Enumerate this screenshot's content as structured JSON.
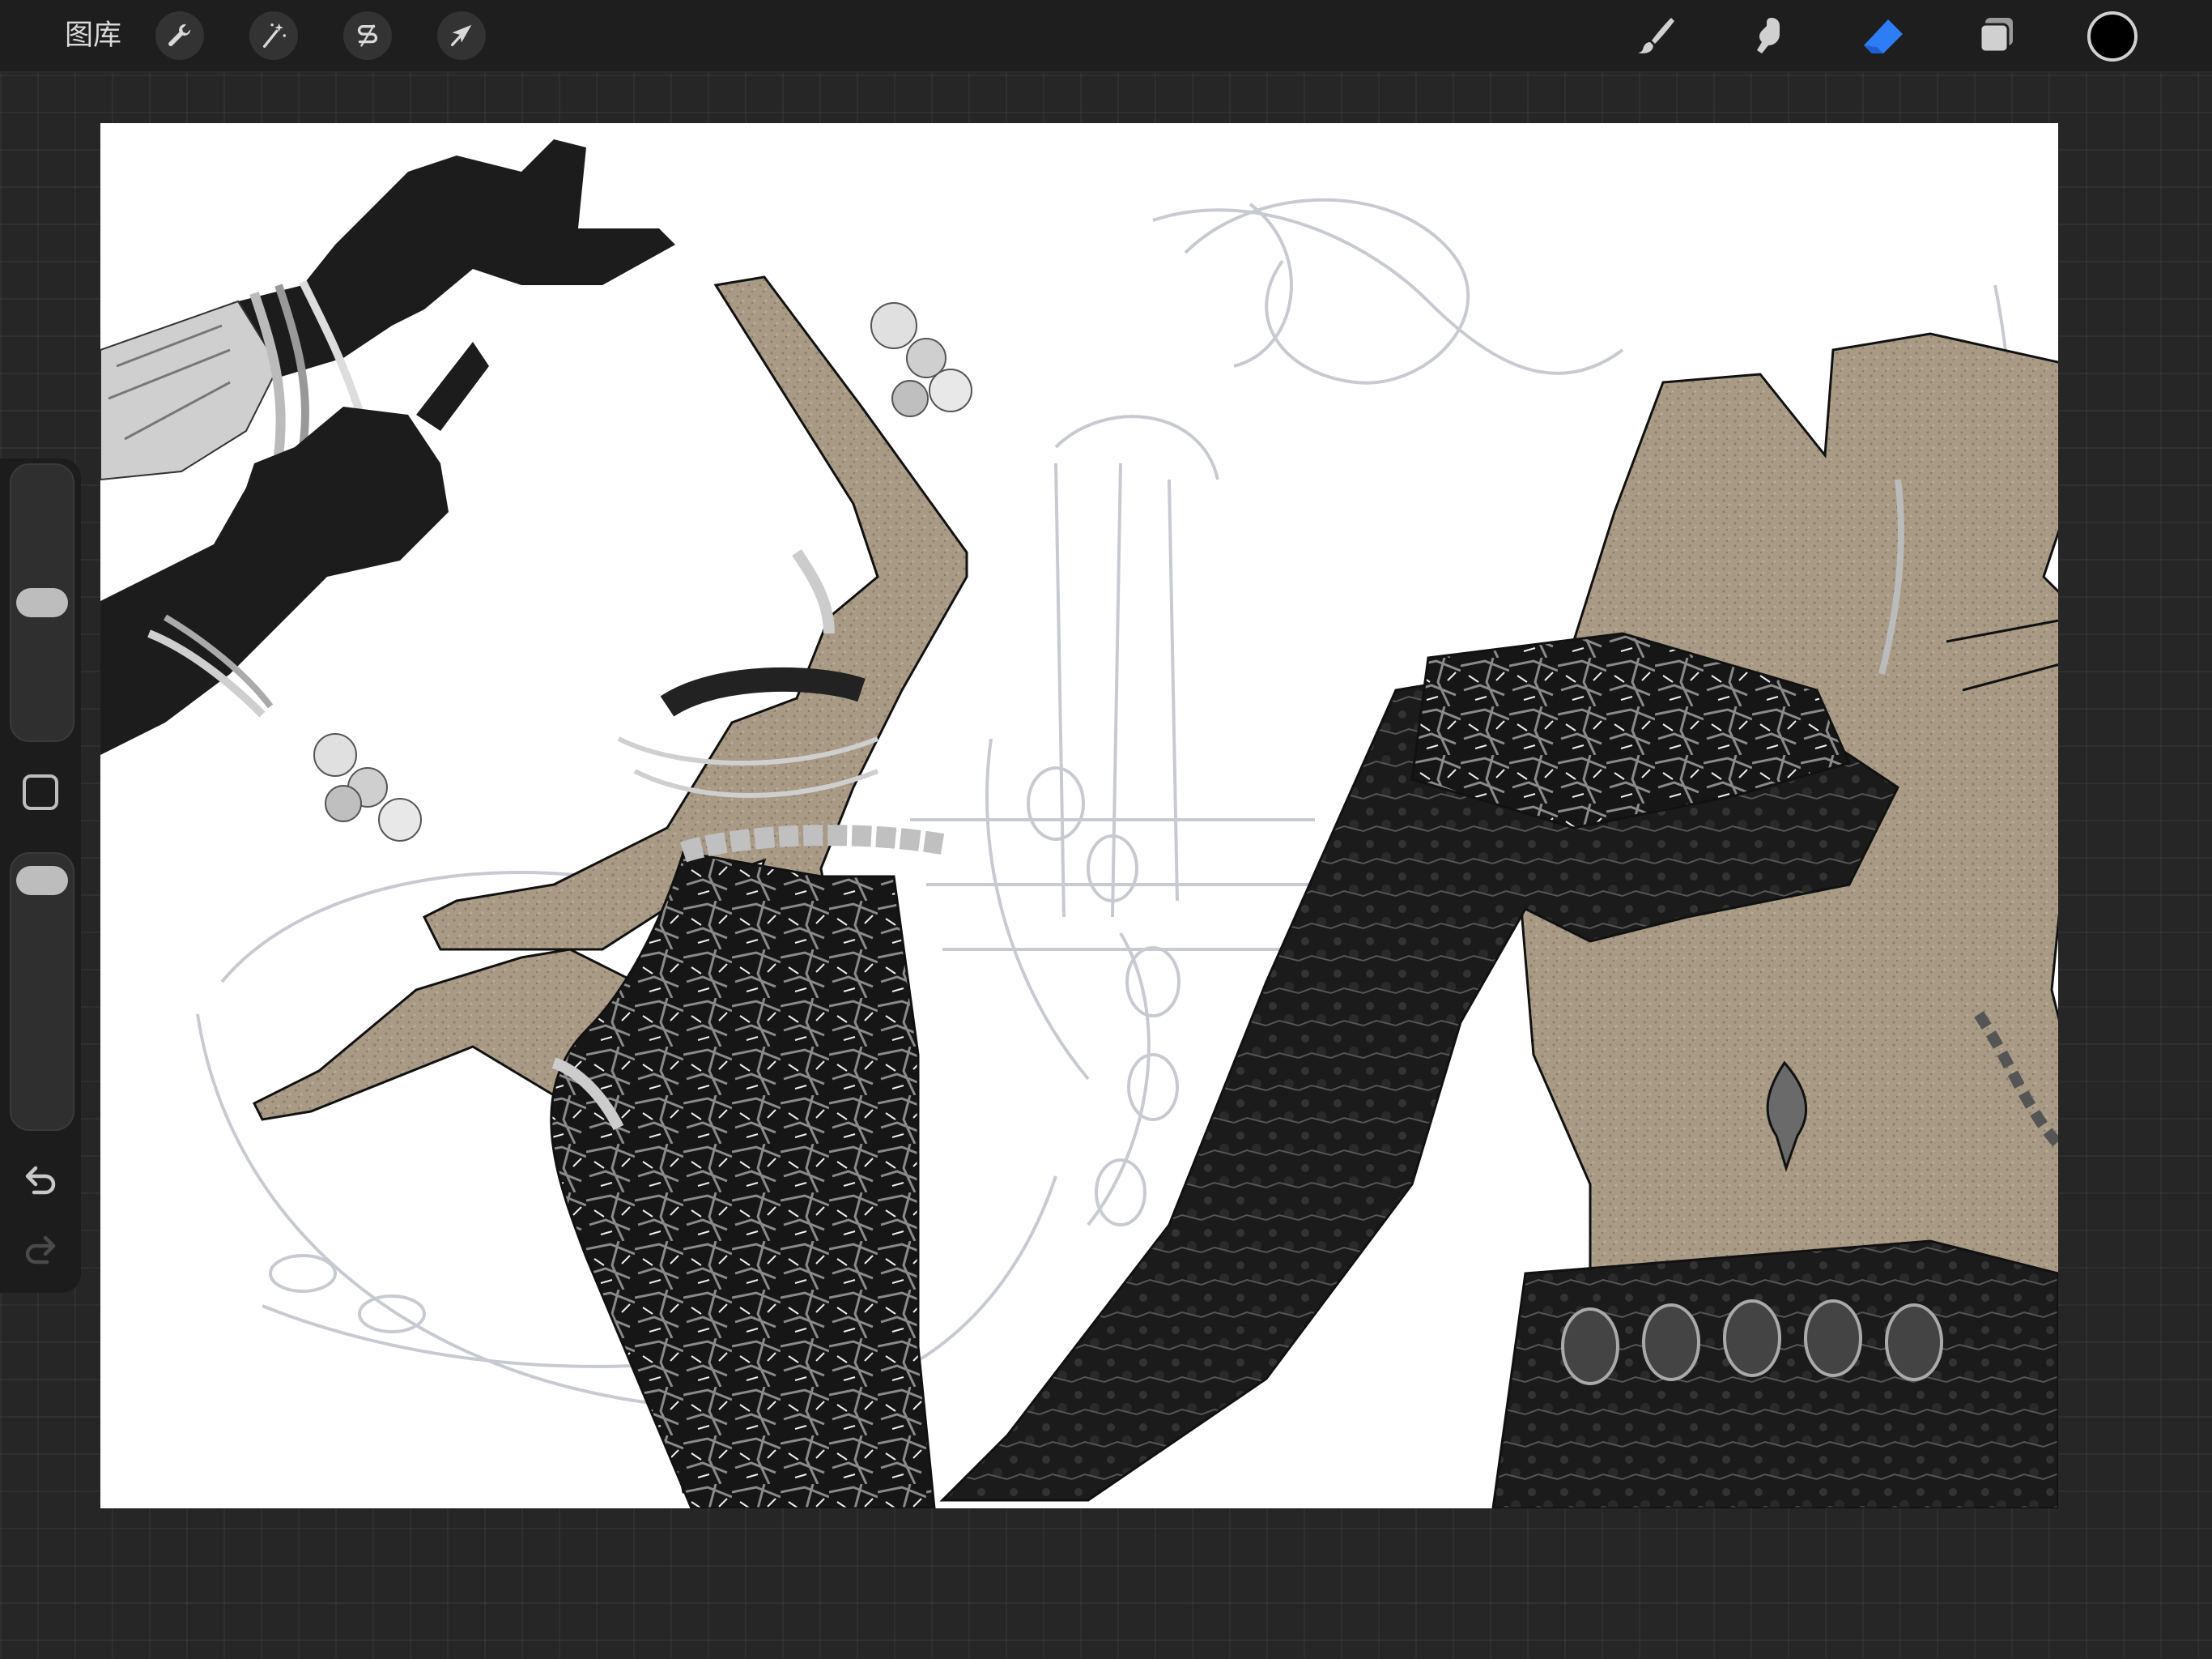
{
  "topbar": {
    "gallery_label": "图库",
    "left_tools": [
      {
        "name": "actions-tool",
        "icon": "wrench-icon"
      },
      {
        "name": "adjustments-tool",
        "icon": "magic-wand-icon"
      },
      {
        "name": "selection-tool",
        "icon": "selection-s-icon"
      },
      {
        "name": "transform-tool",
        "icon": "arrow-cursor-icon"
      }
    ],
    "right_tools": [
      {
        "name": "brush-tool",
        "icon": "brush-icon",
        "active": false
      },
      {
        "name": "smudge-tool",
        "icon": "smudge-finger-icon",
        "active": false
      },
      {
        "name": "eraser-tool",
        "icon": "eraser-icon",
        "active": true
      },
      {
        "name": "layers-tool",
        "icon": "layers-icon",
        "active": false
      }
    ],
    "current_color": "#000000",
    "active_tool_color": "#2e7cf6"
  },
  "sidebar": {
    "brush_size_level": 0.5,
    "opacity_level": 0.03,
    "undo_icon": "undo-arrow-icon",
    "redo_icon": "redo-arrow-icon",
    "modify_icon": "square-icon"
  },
  "canvas": {
    "background": "#ffffff",
    "skin_color": "#a89a85",
    "fabric_color": "#1a1a1a",
    "sketch_color": "#c8cad2"
  }
}
